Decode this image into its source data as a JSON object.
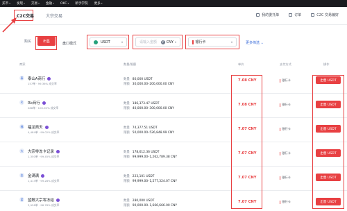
{
  "topnav": [
    {
      "label": "买币"
    },
    {
      "label": "发现"
    },
    {
      "label": "交易"
    },
    {
      "label": "金融"
    },
    {
      "label": "OKC"
    },
    {
      "label": "新手学院"
    },
    {
      "label": "更多"
    }
  ],
  "subnav": {
    "tab_c2c": "C2C交易",
    "tab_block": "大宗交易",
    "my_orders": "我的委托单",
    "orders": "订单",
    "c2c_settings": "C2C 交易偏好"
  },
  "filters": {
    "buy": "购买",
    "sell": "出售",
    "block_mode": "盘口模式",
    "coin": "USDT",
    "amount_placeholder": "请输入金额",
    "currency": "CNY",
    "currency_symbol": "¥",
    "payment": "银行卡",
    "more": "更多筛选"
  },
  "table": {
    "headers": {
      "advertiser": "商家",
      "qty_limit": "数量/限额",
      "price": "单价",
      "payment": "支付方式",
      "action": "操作"
    },
    "qty_label": "数量",
    "limit_label": "限额",
    "sell_label": "出售 USDT",
    "rows": [
      {
        "avatar": "泰",
        "name": "泰山A商行",
        "stats": "157单 · 99.36% 成交率",
        "qty": "80,000 USDT",
        "limit": "30,000.00–200,000.00 CNY",
        "price": "7.08 CNY",
        "payment": "银行卡"
      },
      {
        "avatar": "R",
        "name": "Rk商行",
        "stats": "288单 · 100.00% 成交率",
        "qty": "186,373.47 USDT",
        "limit": "40,000.00–300,000.00 CNY",
        "price": "7.08 CNY",
        "payment": "银行卡"
      },
      {
        "avatar": "福",
        "name": "福龙商天",
        "stats": "4,484单 · 99.02% 成交率",
        "qty": "74,377.51 USDT",
        "limit": "50,000.00–526,848.99 CNY",
        "price": "7.07 CNY",
        "payment": "银行卡"
      },
      {
        "avatar": "大",
        "name": "大宗零冻卡记录",
        "stats": "1,350单 · 99.45% 成交率",
        "qty": "178,612.36 USDT",
        "limit": "99,999.00–1,262,789.38 CNY",
        "price": "7.07 CNY",
        "payment": "银行卡"
      },
      {
        "avatar": "金",
        "name": "金满满",
        "stats": "1,413单 · 99.28% 成交率",
        "qty": "223,101 USDT",
        "limit": "99,999.00–1,577,324.07 CNY",
        "price": "7.07 CNY",
        "payment": "银行卡"
      },
      {
        "avatar": "蓝",
        "name": "蓝鲸大宗零冻结",
        "stats": "3,958单 · 98.78% 成交率",
        "qty": "280,000 USDT",
        "limit": "90,000.00–1,666,666.00 CNY",
        "price": "7.07 CNY",
        "payment": "银行卡"
      }
    ]
  }
}
